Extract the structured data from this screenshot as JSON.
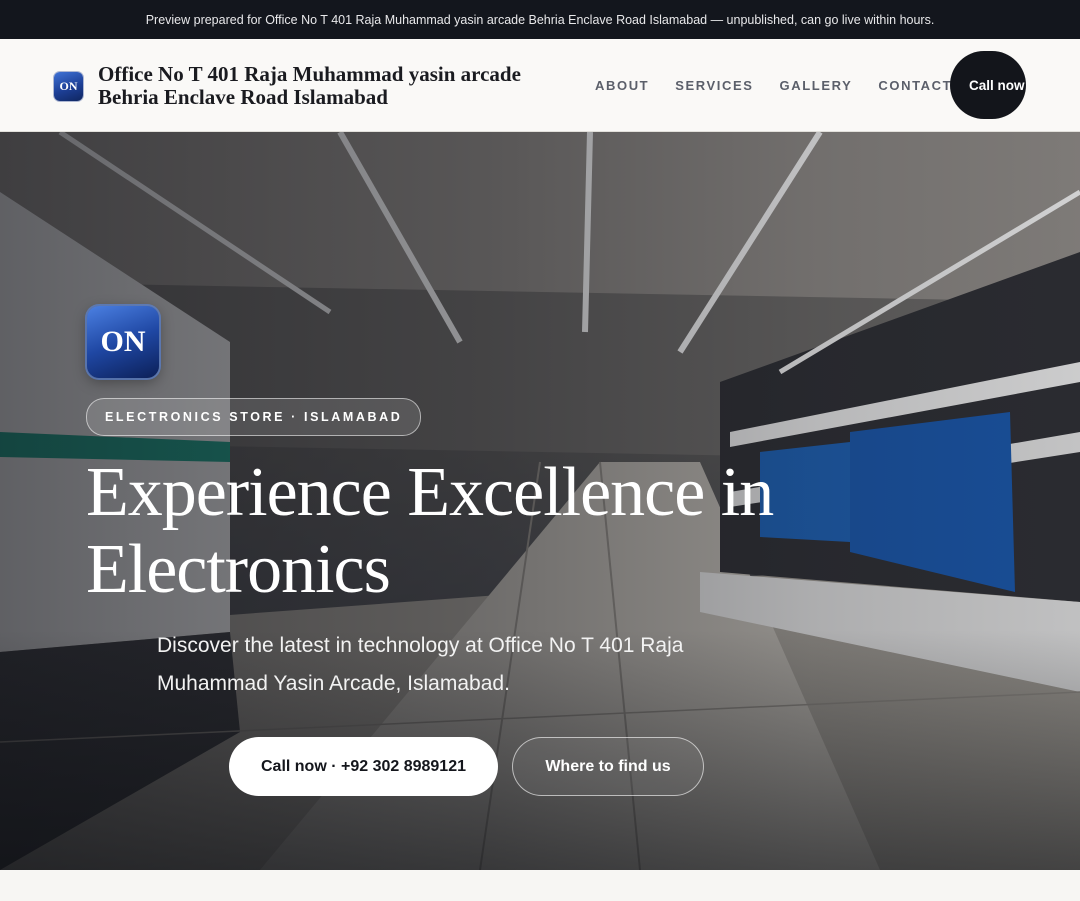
{
  "preview_banner": "Preview prepared for Office No T 401 Raja Muhammad yasin arcade Behria Enclave Road Islamabad — unpublished, can go live within hours.",
  "header": {
    "logo_text": "ON",
    "brand_name": "Office No T 401 Raja Muhammad yasin arcade Behria Enclave Road Islamabad",
    "nav": [
      "ABOUT",
      "SERVICES",
      "GALLERY",
      "CONTACT"
    ],
    "call_button": "Call now"
  },
  "hero": {
    "logo_text": "ON",
    "eyebrow": "ELECTRONICS STORE · ISLAMABAD",
    "headline": "Experience Excellence in Electronics",
    "lede": "Discover the latest in technology at Office No T 401 Raja Muhammad Yasin Arcade, Islamabad.",
    "primary_cta": "Call now · +92 302 8989121",
    "secondary_cta": "Where to find us"
  },
  "colors": {
    "top_bar": "#13161d",
    "brand_blue": "#1f47a3",
    "dark_button": "#13151b"
  }
}
